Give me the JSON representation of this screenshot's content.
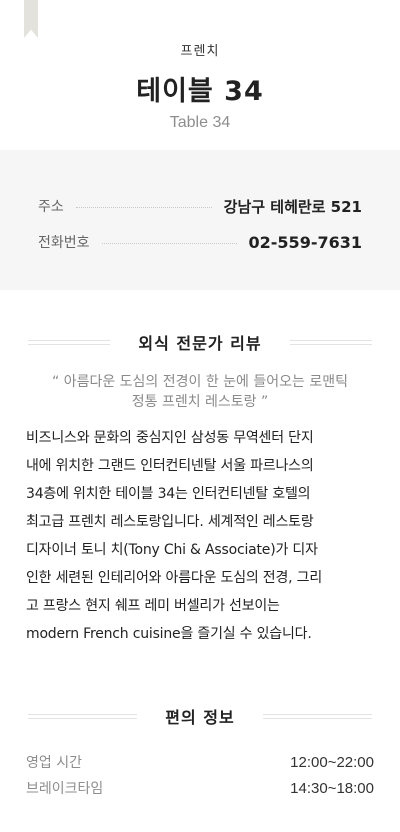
{
  "header": {
    "category": "프렌치",
    "title": "테이블 34",
    "subtitle": "Table 34"
  },
  "info": {
    "address_label": "주소",
    "address_value": "강남구 테헤란로 521",
    "phone_label": "전화번호",
    "phone_value": "02-559-7631"
  },
  "review": {
    "heading": "외식 전문가 리뷰",
    "quote_line1": "“ 아름다운 도심의 전경이 한 눈에 들어오는 로맨틱",
    "quote_line2": "정통 프렌치 레스토랑 ”",
    "body_lines": [
      "비즈니스와 문화의 중심지인 삼성동 무역센터 단지",
      "내에 위치한 그랜드 인터컨티넨탈 서울 파르나스의",
      "34층에 위치한 테이블 34는 인터컨티넨탈 호텔의",
      "최고급 프렌치 레스토랑입니다. 세계적인 레스토랑",
      "디자이너 토니 치(Tony Chi & Associate)가 디자",
      "인한 세련된 인테리어와 아름다운 도심의 전경, 그리",
      "고 프랑스 현지 쉐프 레미 버셀리가 선보이는",
      "modern French cuisine을 즐기실 수 있습니다."
    ]
  },
  "amenities": {
    "heading": "편의 정보",
    "hours": [
      {
        "label": "영업 시간",
        "value": "12:00~22:00"
      },
      {
        "label": "브레이크타임",
        "value": "14:30~18:00"
      }
    ]
  }
}
